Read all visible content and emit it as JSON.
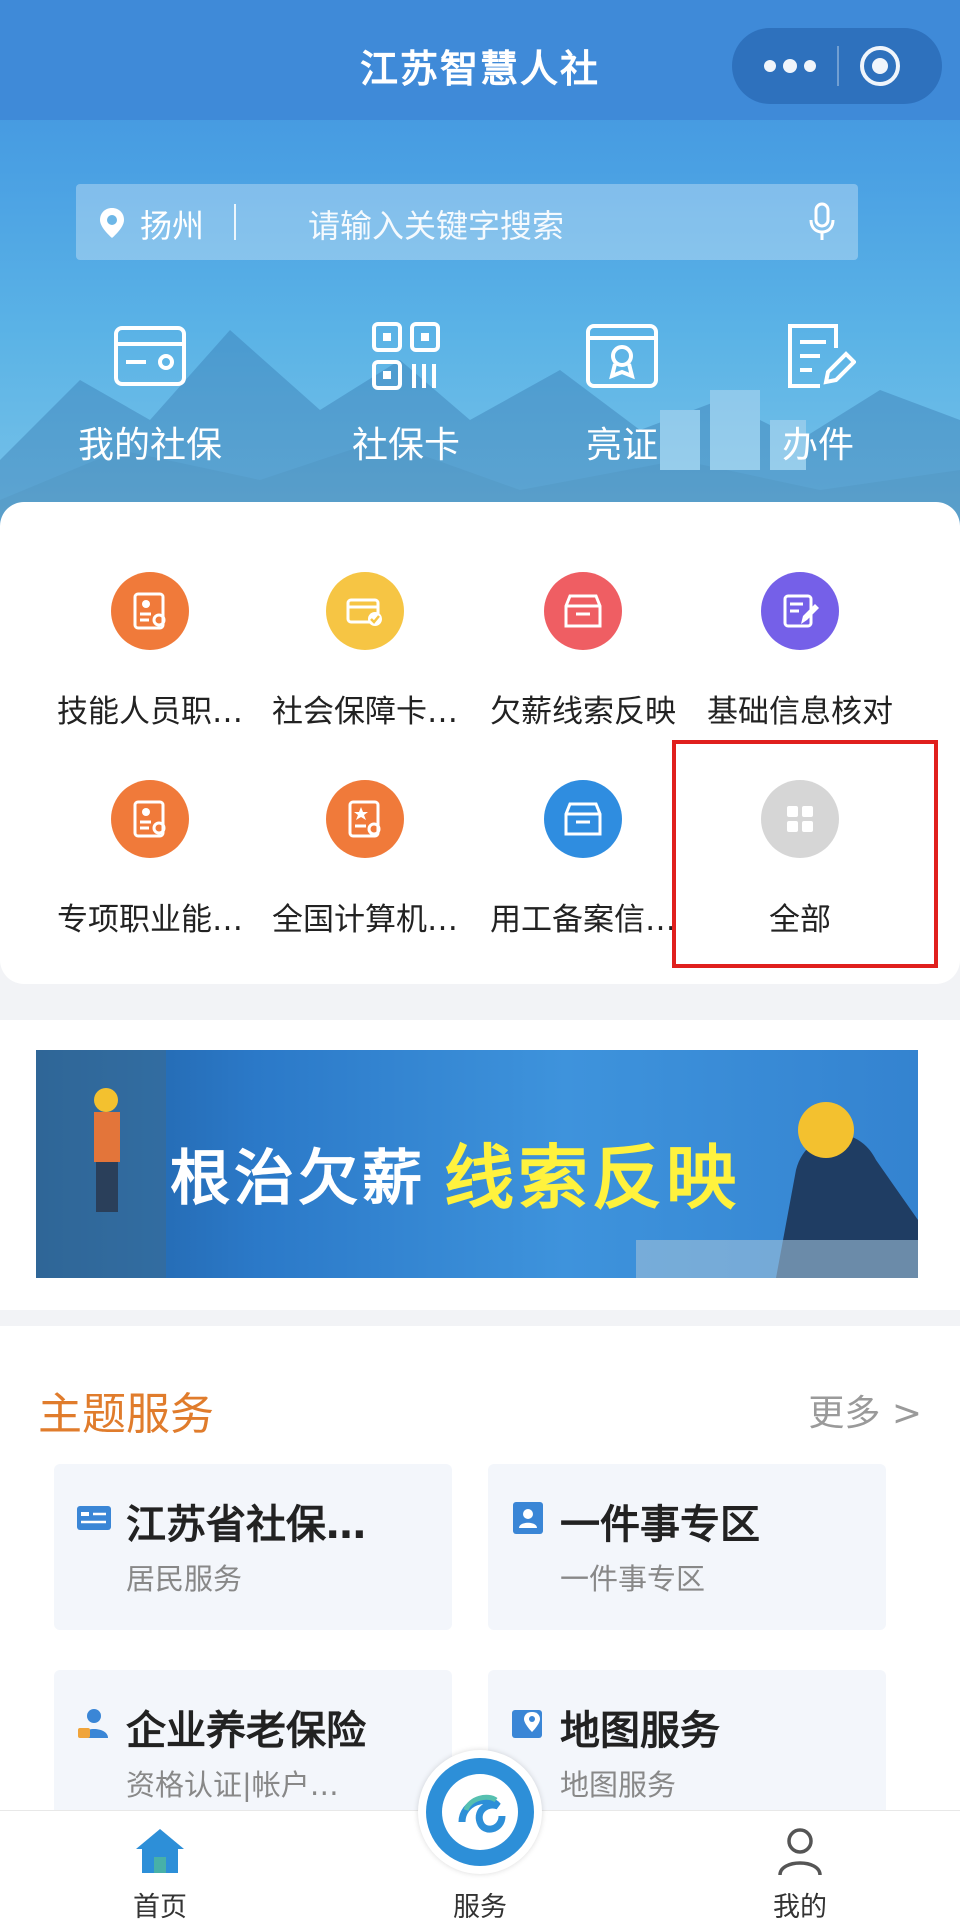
{
  "header": {
    "title": "江苏智慧人社"
  },
  "search": {
    "city": "扬州",
    "placeholder": "请输入关键字搜索"
  },
  "quick_actions": [
    {
      "label": "我的社保",
      "icon": "card-icon"
    },
    {
      "label": "社保卡",
      "icon": "qr-code-icon"
    },
    {
      "label": "亮证",
      "icon": "certificate-icon"
    },
    {
      "label": "办件",
      "icon": "edit-doc-icon"
    }
  ],
  "services": [
    {
      "label": "技能人员职…",
      "icon": "skill-cert-icon",
      "color": "#f07a3a"
    },
    {
      "label": "社会保障卡…",
      "icon": "card-check-icon",
      "color": "#f6c544"
    },
    {
      "label": "欠薪线索反映",
      "icon": "inbox-icon",
      "color": "#ef5e63"
    },
    {
      "label": "基础信息核对",
      "icon": "edit-form-icon",
      "color": "#7560e8"
    },
    {
      "label": "专项职业能…",
      "icon": "vocational-cert-icon",
      "color": "#f07a3a"
    },
    {
      "label": "全国计算机…",
      "icon": "computer-cert-icon",
      "color": "#f07a3a"
    },
    {
      "label": "用工备案信…",
      "icon": "inbox-icon",
      "color": "#2f8de0"
    },
    {
      "label": "全部",
      "icon": "grid-icon",
      "color": "#d6d6d6"
    }
  ],
  "banner": {
    "text_white": "根治欠薪",
    "text_yellow": "线索反映"
  },
  "theme_services": {
    "title": "主题服务",
    "more": "更多 >",
    "items": [
      {
        "title": "江苏省社保…",
        "subtitle": "居民服务",
        "icon": "id-card-icon"
      },
      {
        "title": "一件事专区",
        "subtitle": "一件事专区",
        "icon": "person-badge-icon"
      },
      {
        "title": "企业养老保险",
        "subtitle": "资格认证|帐户…",
        "icon": "pension-icon"
      },
      {
        "title": "地图服务",
        "subtitle": "地图服务",
        "icon": "map-pin-icon"
      }
    ]
  },
  "tabbar": {
    "items": [
      {
        "label": "首页",
        "icon": "home-icon"
      },
      {
        "label": "服务",
        "icon": "service-logo-icon"
      },
      {
        "label": "我的",
        "icon": "user-icon"
      }
    ]
  }
}
